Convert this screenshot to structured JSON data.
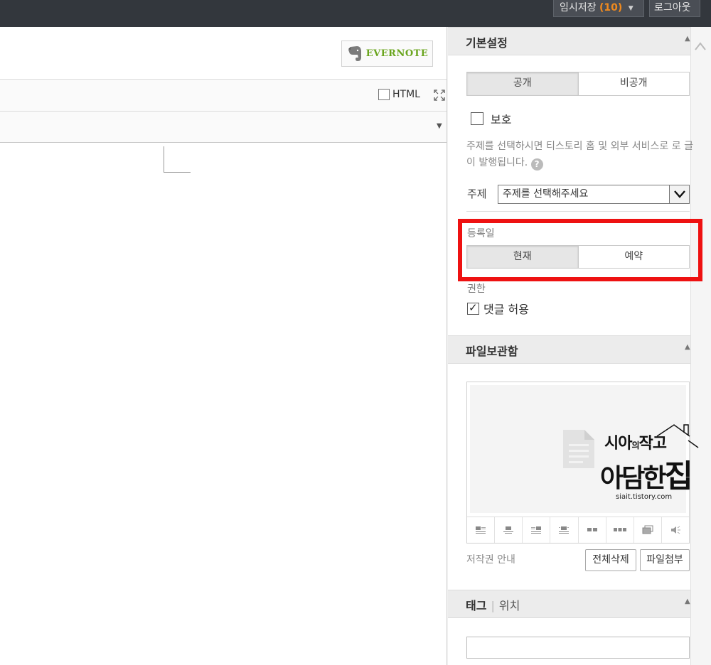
{
  "topbar": {
    "temp_save_label": "임시저장",
    "temp_save_count": "(10)",
    "logout_label": "로그아웃"
  },
  "editor": {
    "evernote_label": "EVERNOTE",
    "html_label": "HTML"
  },
  "settings": {
    "title": "기본설정",
    "visibility": {
      "public": "공개",
      "private": "비공개",
      "selected": "공개"
    },
    "protect_label": "보호",
    "description": "주제를 선택하시면 티스토리 홈 및 외부 서비스로 로 글이 발행됩니다.",
    "help_glyph": "?",
    "subject_label": "주제",
    "subject_value": "주제를 선택해주세요",
    "regdate_label": "등록일",
    "regdate": {
      "now": "현재",
      "reserve": "예약",
      "selected": "현재"
    },
    "permission_label": "권한",
    "comment_allow_label": "댓글 허용",
    "comment_allow_checked": true
  },
  "files": {
    "title": "파일보관함",
    "copyright_label": "저작권 안내",
    "delete_all_label": "전체삭제",
    "attach_label": "파일첨부",
    "tools": [
      "align-left-icon",
      "align-center-icon",
      "align-right-icon",
      "align-justify-icon",
      "two-column-icon",
      "three-column-icon",
      "gallery-icon",
      "audio-icon"
    ]
  },
  "tags": {
    "title": "태그",
    "location_label": "위치",
    "input_value": ""
  },
  "watermark": {
    "line1_a": "시아",
    "line1_b": "의",
    "line1_c": "작고",
    "line2": "아담한",
    "line2_big": "집",
    "url": "siait.tistory.com"
  },
  "colors": {
    "topbar_bg": "#33373d",
    "count_accent": "#f08a1e",
    "evernote_green": "#6aa51e",
    "highlight_red": "#ee1111"
  }
}
